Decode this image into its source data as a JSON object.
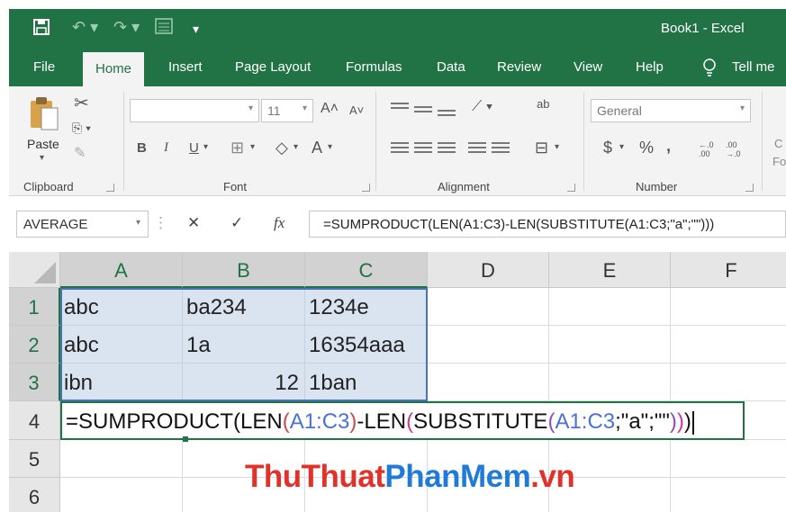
{
  "window": {
    "title": "Book1  -  Excel"
  },
  "tabs": [
    "File",
    "Home",
    "Insert",
    "Page Layout",
    "Formulas",
    "Data",
    "Review",
    "View",
    "Help"
  ],
  "active_tab": "Home",
  "tell_me": "Tell me w",
  "ribbon": {
    "clipboard": {
      "paste_label": "Paste",
      "group_label": "Clipboard"
    },
    "font": {
      "font_name": "",
      "font_size": "11",
      "group_label": "Font",
      "grow_label": "A˄",
      "shrink_label": "A˅",
      "bold": "B",
      "italic": "I",
      "underline": "U",
      "color_a": "A"
    },
    "alignment": {
      "group_label": "Alignment",
      "wrap_label": "ab"
    },
    "number": {
      "format": "General",
      "currency": "$",
      "percent": "%",
      "comma": ",",
      "inc_dec": "←.0 .00",
      "dec_dec": ".00 →.0",
      "group_label": "Number"
    },
    "styles": {
      "partial_label_1": "C",
      "partial_label_2": "Fo"
    }
  },
  "formula_bar": {
    "name_box": "AVERAGE",
    "cancel_glyph": "✕",
    "enter_glyph": "✓",
    "fx_glyph": "fx",
    "formula": "=SUMPRODUCT(LEN(A1:C3)-LEN(SUBSTITUTE(A1:C3;\"a\";\"\")))"
  },
  "grid": {
    "columns": [
      "A",
      "B",
      "C",
      "D",
      "E",
      "F"
    ],
    "rows": [
      "1",
      "2",
      "3",
      "4",
      "5",
      "6"
    ],
    "cells": {
      "A1": "abc",
      "B1": "ba234",
      "C1": "1234e",
      "A2": "abc",
      "B2": "1a",
      "C2": "16354aaa",
      "A3": "ibn",
      "B3": "12",
      "C3": "1ban"
    },
    "edit_tokens": {
      "t1": "=SUMPRODUCT(LEN",
      "t2": "(",
      "t3": "A1:C3",
      "t4": ")",
      "t5": "-LEN",
      "t6": "(",
      "t7": "SUBSTITUTE",
      "t8": "(",
      "t9": "A1:C3",
      "t10": ";\"a\";\"\"",
      "t11": ")",
      "t12": ")",
      "t13": ")"
    }
  },
  "watermark": {
    "part1": "ThuThuat",
    "part2": "PhanMem",
    "part3": ".vn"
  },
  "colors": {
    "excel_green": "#217346",
    "selection_fill": "#dae3f0",
    "range_border": "#4a72b6",
    "ref_color_1": "#4a72d6",
    "ref_color_2": "#8a4fbe"
  }
}
